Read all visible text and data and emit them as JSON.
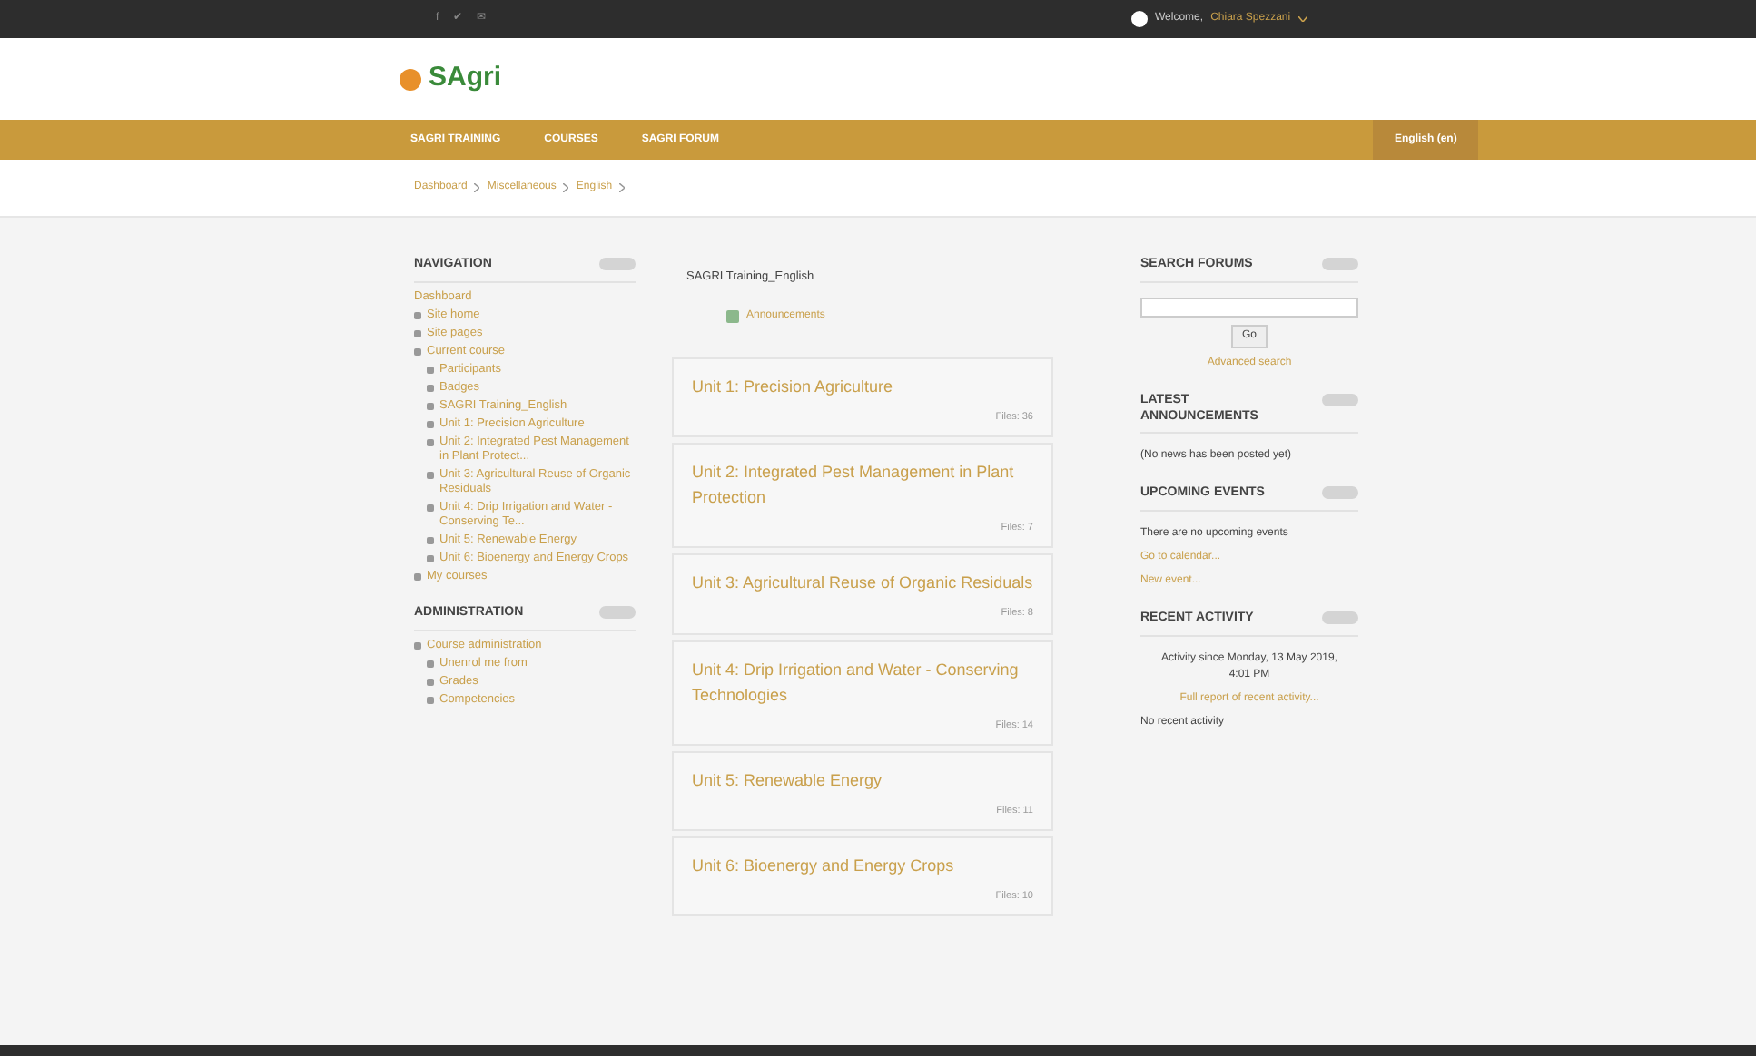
{
  "topbar": {
    "social": [
      "f",
      "✔",
      "✉"
    ],
    "welcome": "Welcome,",
    "user": "Chiara Spezzani"
  },
  "nav": {
    "items": [
      "SAGRI TRAINING",
      "COURSES",
      "SAGRI FORUM"
    ],
    "language": "English (en)"
  },
  "logo": {
    "text": "SAgri"
  },
  "breadcrumb": [
    "Dashboard",
    "Miscellaneous",
    "English"
  ],
  "navigation": {
    "title": "NAVIGATION",
    "items": [
      {
        "label": "Dashboard",
        "kind": "plain"
      },
      {
        "label": "Site home",
        "kind": "bullet"
      },
      {
        "label": "Site pages",
        "kind": "bullet"
      },
      {
        "label": "Current course",
        "kind": "bullet",
        "children": [
          {
            "label": "Participants",
            "kind": "bullet"
          },
          {
            "label": "Badges",
            "kind": "bullet"
          },
          {
            "label": "SAGRI Training_English",
            "kind": "bullet"
          },
          {
            "label": "Unit 1: Precision Agriculture",
            "kind": "bullet"
          },
          {
            "label": "Unit 2: Integrated Pest Management in Plant Protect...",
            "kind": "bullet"
          },
          {
            "label": "Unit 3: Agricultural Reuse of Organic Residuals",
            "kind": "bullet"
          },
          {
            "label": "Unit 4: Drip Irrigation and Water - Conserving Te...",
            "kind": "bullet"
          },
          {
            "label": "Unit 5: Renewable Energy",
            "kind": "bullet"
          },
          {
            "label": "Unit 6: Bioenergy and Energy Crops",
            "kind": "bullet"
          }
        ]
      },
      {
        "label": "My courses",
        "kind": "bullet"
      }
    ]
  },
  "administration": {
    "title": "ADMINISTRATION",
    "items": [
      {
        "label": "Course administration",
        "kind": "bullet",
        "children": [
          {
            "label": "Unenrol me from",
            "kind": "bullet"
          },
          {
            "label": "Grades",
            "kind": "bullet"
          },
          {
            "label": "Competencies",
            "kind": "bullet"
          }
        ]
      }
    ]
  },
  "course": {
    "title": "SAGRI Training_English",
    "activity": "Announcements",
    "units": [
      {
        "title": "Unit 1: Precision Agriculture",
        "files": "Files: 36"
      },
      {
        "title": "Unit 2: Integrated Pest Management in Plant Protection",
        "files": "Files: 7"
      },
      {
        "title": "Unit 3: Agricultural Reuse of Organic Residuals",
        "files": "Files: 8"
      },
      {
        "title": "Unit 4: Drip Irrigation and Water - Conserving Technologies",
        "files": "Files: 14"
      },
      {
        "title": "Unit 5: Renewable Energy",
        "files": "Files: 11"
      },
      {
        "title": "Unit 6: Bioenergy and Energy Crops",
        "files": "Files: 10"
      }
    ]
  },
  "search_forums": {
    "title": "SEARCH FORUMS",
    "button": "Go",
    "link": "Advanced search"
  },
  "latest_announcements": {
    "title": "LATEST ANNOUNCEMENTS",
    "text": "(No news has been posted yet)"
  },
  "upcoming_events": {
    "title": "UPCOMING EVENTS",
    "text": "There are no upcoming events",
    "links": [
      "Go to calendar...",
      "New event..."
    ]
  },
  "recent_activity": {
    "title": "RECENT ACTIVITY",
    "since": "Activity since Monday, 13 May 2019, 4:01 PM",
    "link": "Full report of recent activity...",
    "text": "No recent activity"
  }
}
